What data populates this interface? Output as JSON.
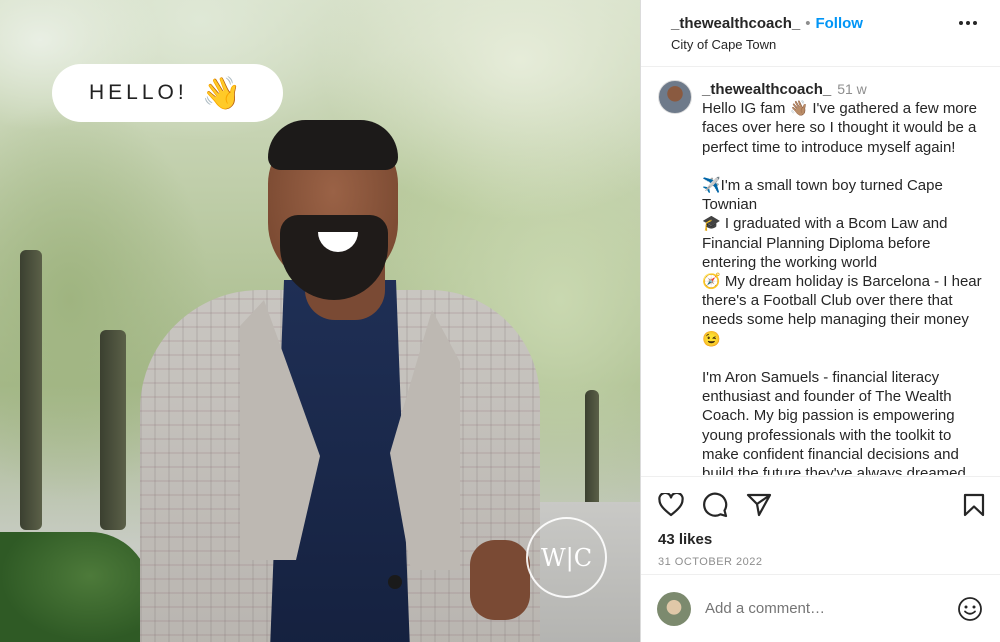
{
  "photo": {
    "hello_text": "HELLO!",
    "hello_emoji": "👋",
    "logo_text": "W|C"
  },
  "header": {
    "username": "_thewealthcoach_",
    "separator": "•",
    "follow_label": "Follow",
    "location": "City of Cape Town",
    "more_icon": "more-horizontal-icon"
  },
  "caption": {
    "username": "_thewealthcoach_",
    "time": "51 w",
    "lines": [
      "Hello IG fam 👋🏽 I've gathered a few more faces over here so I thought it would be a perfect time to introduce myself again!",
      "",
      "✈️I'm a small town boy turned Cape Townian",
      "🎓 I graduated with a Bcom Law and Financial Planning Diploma before entering the working world",
      "🧭 My dream holiday is Barcelona - I hear there's a Football Club over there that needs some help managing their money 😉",
      "",
      "I'm Aron Samuels - financial literacy enthusiast and founder of The Wealth Coach. My big passion is empowering young professionals with the toolkit to make confident financial decisions and build the future they've always dreamed"
    ]
  },
  "actions": {
    "likes": "43 likes",
    "date": "31 OCTOBER 2022"
  },
  "comment": {
    "placeholder": "Add a comment…"
  }
}
